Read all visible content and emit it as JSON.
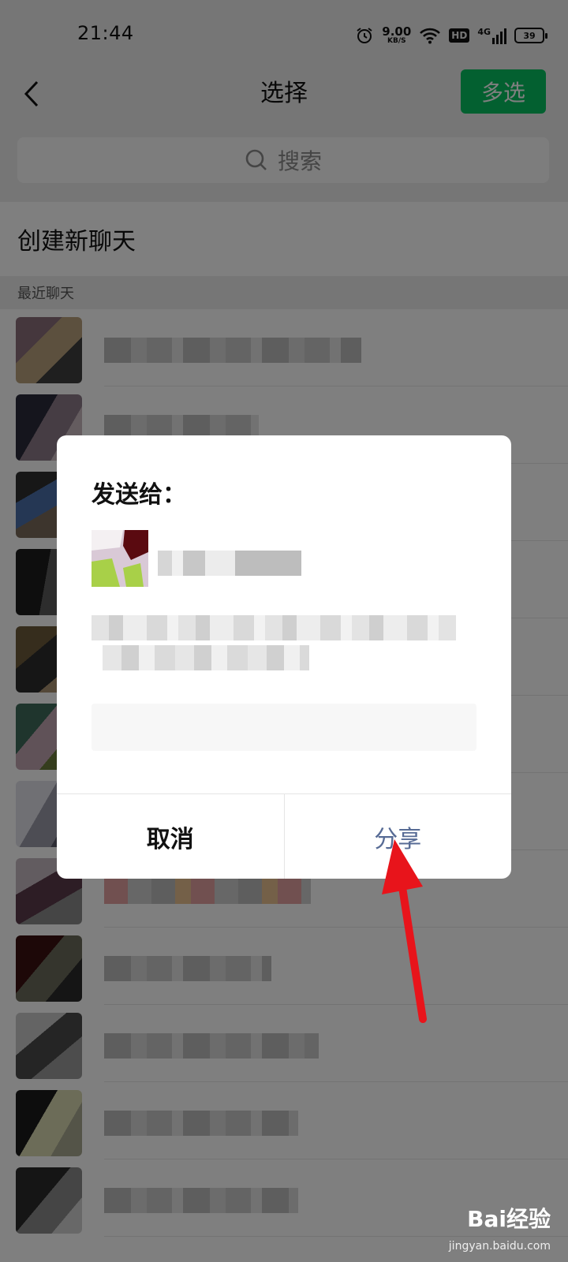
{
  "status_bar": {
    "time": "21:44",
    "net_speed_value": "9.00",
    "net_speed_unit": "KB/S",
    "hd_label": "HD",
    "network_type": "4G",
    "battery_level": "39"
  },
  "header": {
    "title": "选择",
    "multi_select_label": "多选"
  },
  "search": {
    "placeholder": "搜索"
  },
  "list": {
    "new_chat_label": "创建新聊天",
    "section_label": "最近聊天"
  },
  "dialog": {
    "title": "发送给：",
    "cancel_label": "取消",
    "share_label": "分享"
  },
  "watermark": {
    "brand": "Bai经验",
    "url": "jingyan.baidu.com"
  },
  "colors": {
    "accent_green": "#07c160",
    "link_blue": "#576b95",
    "arrow_red": "#e8141b"
  }
}
